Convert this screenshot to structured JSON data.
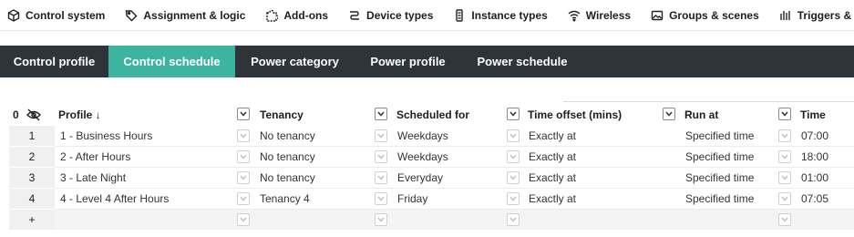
{
  "topnav": {
    "items": [
      {
        "label": "Control system",
        "icon": "cube-icon"
      },
      {
        "label": "Assignment & logic",
        "icon": "tag-icon"
      },
      {
        "label": "Add-ons",
        "icon": "puzzle-icon"
      },
      {
        "label": "Device types",
        "icon": "link-icon"
      },
      {
        "label": "Instance types",
        "icon": "device-icon"
      },
      {
        "label": "Wireless",
        "icon": "wifi-icon"
      },
      {
        "label": "Groups & scenes",
        "icon": "image-icon"
      },
      {
        "label": "Triggers & sequences",
        "icon": "bars-icon"
      }
    ]
  },
  "tabs": [
    {
      "label": "Control profile",
      "active": false
    },
    {
      "label": "Control schedule",
      "active": true
    },
    {
      "label": "Power category",
      "active": false
    },
    {
      "label": "Power profile",
      "active": false
    },
    {
      "label": "Power schedule",
      "active": false
    }
  ],
  "grid": {
    "count_label": "0",
    "headers": {
      "profile": "Profile ↓",
      "tenancy": "Tenancy",
      "scheduled_for": "Scheduled for",
      "time_offset": "Time offset (mins)",
      "run_at": "Run at",
      "time": "Time"
    },
    "rows": [
      {
        "num": "1",
        "profile": "1 - Business Hours",
        "tenancy": "No tenancy",
        "scheduled_for": "Weekdays",
        "time_offset": "Exactly at",
        "run_at": "Specified time",
        "time": "07:00"
      },
      {
        "num": "2",
        "profile": "2 - After Hours",
        "tenancy": "No tenancy",
        "scheduled_for": "Weekdays",
        "time_offset": "Exactly at",
        "run_at": "Specified time",
        "time": "18:00"
      },
      {
        "num": "3",
        "profile": "3 - Late Night",
        "tenancy": "No tenancy",
        "scheduled_for": "Everyday",
        "time_offset": "Exactly at",
        "run_at": "Specified time",
        "time": "01:00"
      },
      {
        "num": "4",
        "profile": "4 - Level 4 After Hours",
        "tenancy": "Tenancy 4",
        "scheduled_for": "Friday",
        "time_offset": "Exactly at",
        "run_at": "Specified time",
        "time": "07:05"
      }
    ],
    "new_row_label": "+"
  },
  "colors": {
    "tab_bar_bg": "#2e343a",
    "tab_active_bg": "#3cb4a0"
  }
}
